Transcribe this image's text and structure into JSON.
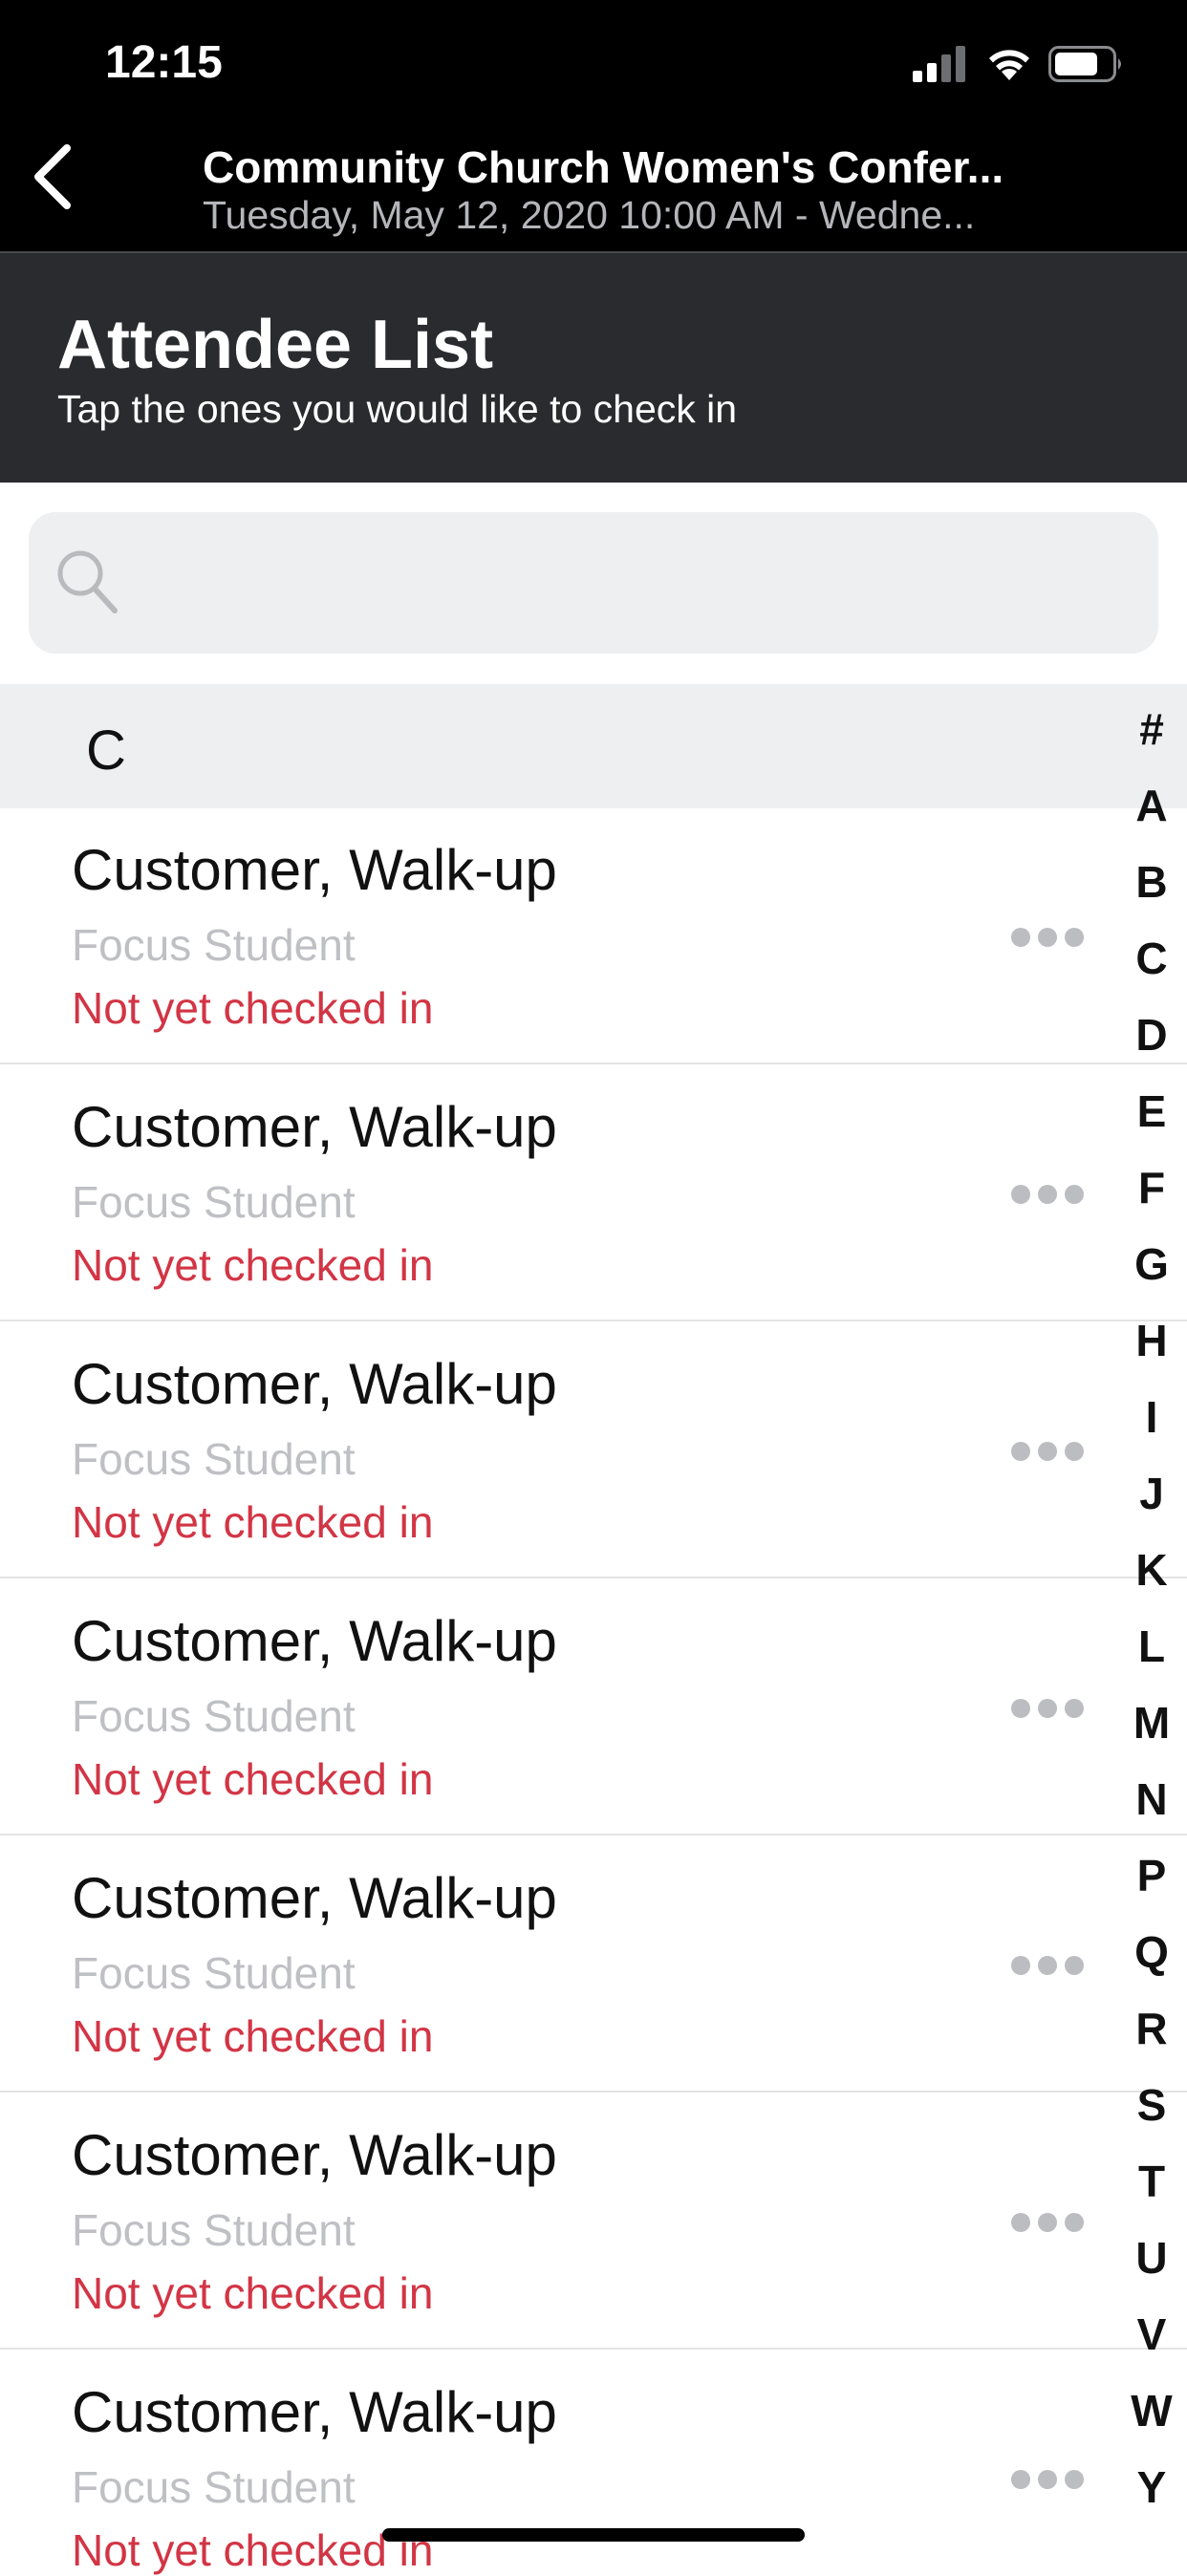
{
  "status_bar": {
    "time": "12:15",
    "signal_icon": "cellular-signal-icon",
    "wifi_icon": "wifi-icon",
    "battery_icon": "battery-icon"
  },
  "nav": {
    "back_icon": "chevron-left-icon",
    "title": "Community Church Women's Confer...",
    "subtitle": "Tuesday, May 12, 2020 10:00 AM - Wedne..."
  },
  "header": {
    "title": "Attendee List",
    "instructions": "Tap the ones you would like to check in"
  },
  "search": {
    "placeholder": "",
    "value": "",
    "icon": "search-icon"
  },
  "section": {
    "letter": "C"
  },
  "attendees": [
    {
      "name": "Customer, Walk-up",
      "role": "Focus Student",
      "status": "Not yet checked in"
    },
    {
      "name": "Customer, Walk-up",
      "role": "Focus Student",
      "status": "Not yet checked in"
    },
    {
      "name": "Customer, Walk-up",
      "role": "Focus Student",
      "status": "Not yet checked in"
    },
    {
      "name": "Customer, Walk-up",
      "role": "Focus Student",
      "status": "Not yet checked in"
    },
    {
      "name": "Customer, Walk-up",
      "role": "Focus Student",
      "status": "Not yet checked in"
    },
    {
      "name": "Customer, Walk-up",
      "role": "Focus Student",
      "status": "Not yet checked in"
    },
    {
      "name": "Customer, Walk-up",
      "role": "Focus Student",
      "status": "Not yet checked in"
    }
  ],
  "alphabet_index": [
    "#",
    "A",
    "B",
    "C",
    "D",
    "E",
    "F",
    "G",
    "H",
    "I",
    "J",
    "K",
    "L",
    "M",
    "N",
    "P",
    "Q",
    "R",
    "S",
    "T",
    "U",
    "V",
    "W",
    "Y"
  ],
  "colors": {
    "header_bg": "#2a2b2e",
    "status_not_checked_in": "#d23545",
    "secondary_text": "#bfc0c4"
  }
}
